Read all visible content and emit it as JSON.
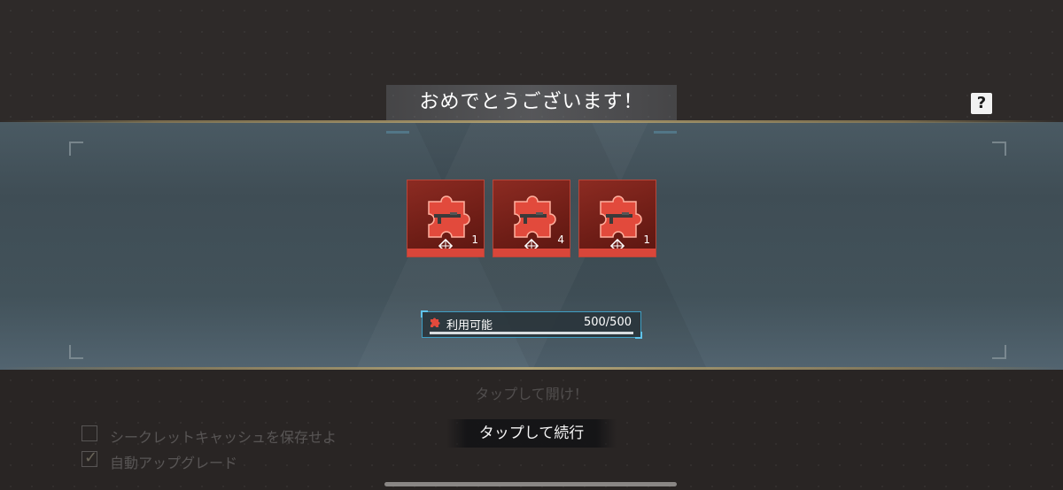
{
  "header": {
    "title": "おめでとうございます！",
    "help_label": "?"
  },
  "rewards": [
    {
      "count": "1",
      "icon": "puzzle-piece-rifle-icon"
    },
    {
      "count": "4",
      "icon": "puzzle-piece-rifle-icon"
    },
    {
      "count": "1",
      "icon": "puzzle-piece-rifle-icon"
    }
  ],
  "gauge": {
    "label": "利用可能",
    "value": "500/500",
    "fill_fraction": 1.0,
    "icon": "puzzle-piece-icon"
  },
  "background": {
    "tap_to_open": "タップして開け！",
    "options": [
      {
        "label": "シークレットキャッシュを保存せよ",
        "checked": false
      },
      {
        "label": "自動アップグレード",
        "checked": true
      }
    ]
  },
  "continue_label": "タップして続行",
  "colors": {
    "reward_bg": "#7a231b",
    "reward_bar": "#d9463a",
    "gauge_border": "#3f9fc4",
    "band": "#45555e",
    "gold_line": "#c9b47a"
  }
}
